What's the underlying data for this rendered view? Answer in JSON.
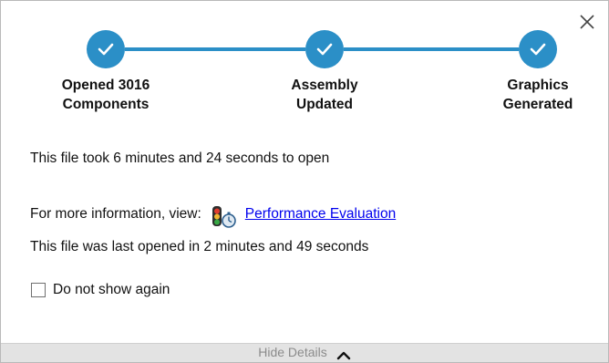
{
  "dialog": {
    "close_icon": "close-icon"
  },
  "progress": {
    "steps": [
      {
        "label": "Opened 3016\nComponents",
        "status": "complete"
      },
      {
        "label": "Assembly\nUpdated",
        "status": "complete"
      },
      {
        "label": "Graphics\nGenerated",
        "status": "complete"
      }
    ],
    "accent_color": "#2b8fc7"
  },
  "messages": {
    "open_time": "This file took 6 minutes and 24 seconds to open",
    "more_info_prefix": "For more information, view:",
    "more_info_icon": "performance-evaluation-icon",
    "more_info_link": "Performance Evaluation",
    "last_opened": "This file was last opened in 2 minutes and 49 seconds"
  },
  "options": {
    "do_not_show_label": "Do not show again",
    "do_not_show_checked": false
  },
  "footer": {
    "toggle_label": "Hide Details",
    "toggle_icon": "chevron-up-icon"
  }
}
